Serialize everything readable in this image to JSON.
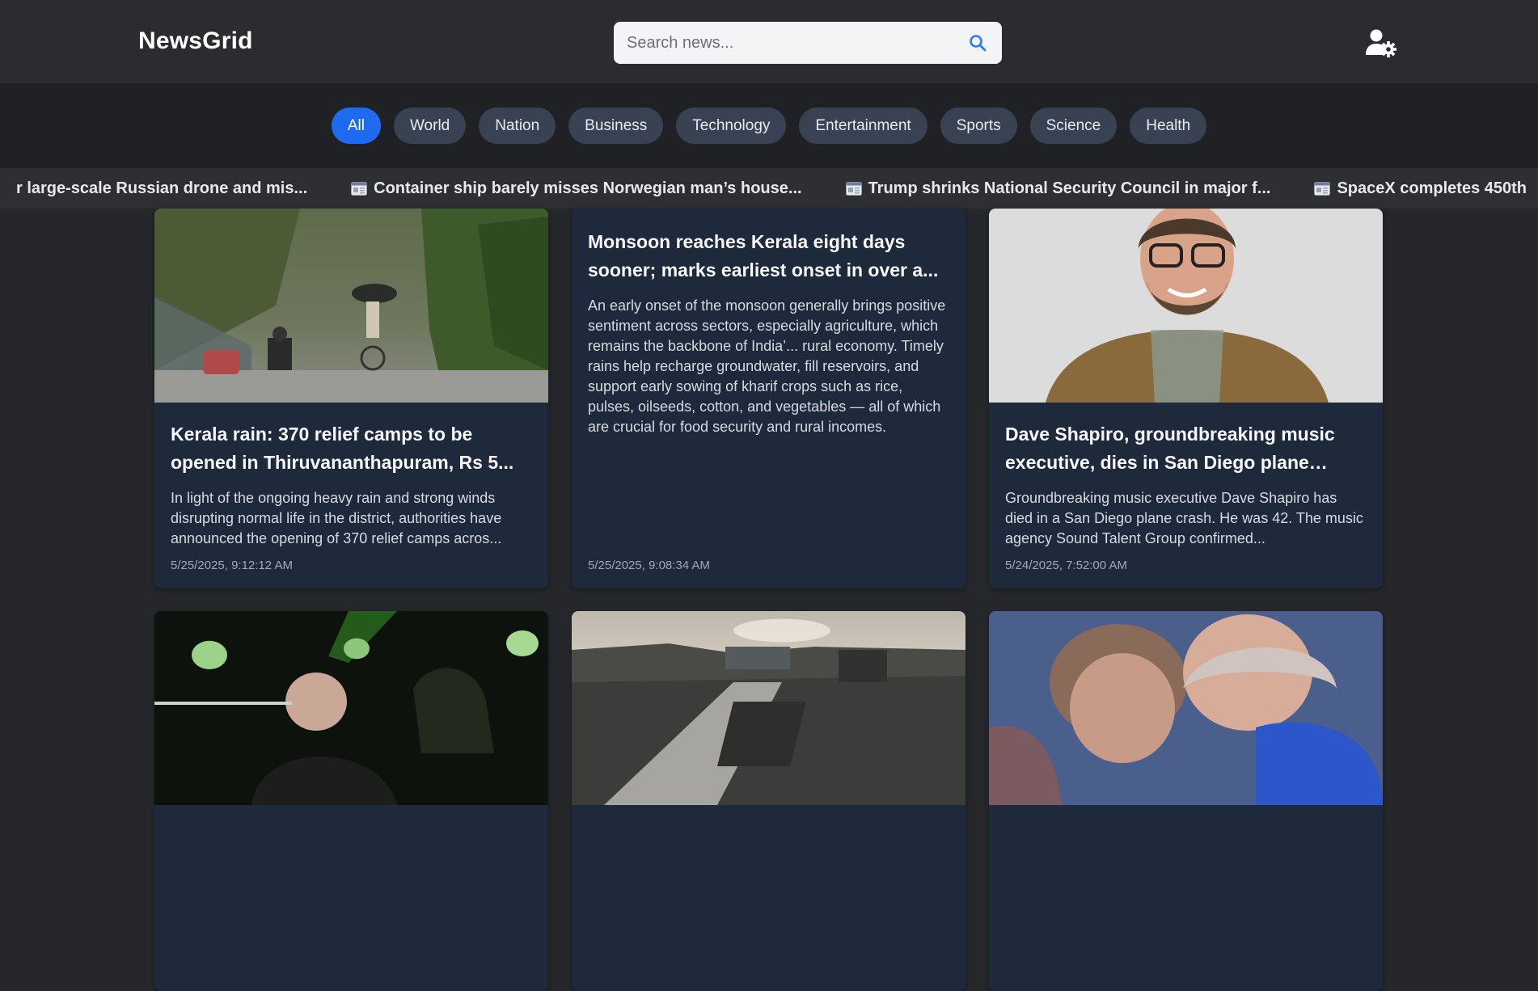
{
  "app": {
    "title": "NewsGrid"
  },
  "search": {
    "placeholder": "Search news..."
  },
  "categories": [
    "All",
    "World",
    "Nation",
    "Business",
    "Technology",
    "Entertainment",
    "Sports",
    "Science",
    "Health"
  ],
  "ticker": [
    "r large-scale Russian drone and mis...",
    "Container ship barely misses Norwegian man’s house...",
    "Trump shrinks National Security Council in major f...",
    "SpaceX completes 450th"
  ],
  "articles": [
    {
      "title": "Kerala rain: 370 relief camps to be opened in Thiruvananthapuram, Rs 5...",
      "description": "In light of the ongoing heavy rain and strong winds disrupting normal life in the district, authorities have announced the opening of 370 relief camps acros...",
      "date": "5/25/2025, 9:12:12 AM"
    },
    {
      "title": "Monsoon reaches Kerala eight days sooner; marks earliest onset in over a...",
      "description": "An early onset of the monsoon generally brings positive sentiment across sectors, especially agriculture, which remains the backbone of India’... rural economy. Timely rains help recharge groundwater, fill reservoirs, and support early sowing of kharif crops such as rice, pulses, oilseeds, cotton, and vegetables — all of which are crucial for food security and rural incomes.",
      "date": "5/25/2025, 9:08:34 AM"
    },
    {
      "title": "Dave Shapiro, groundbreaking music executive, dies in San Diego plane cras...",
      "description": "Groundbreaking music executive Dave Shapiro has died in a San Diego plane crash. He was 42. The music agency Sound Talent Group confirmed...",
      "date": "5/24/2025, 7:52:00 AM"
    }
  ],
  "colors": {
    "accent": "#1f6bf0",
    "card": "#1e293b",
    "pill": "#384252",
    "background": "#25272b"
  },
  "icons": {
    "search": "search-icon",
    "user_settings": "user-gear-icon",
    "ticker": "newspaper-icon"
  }
}
